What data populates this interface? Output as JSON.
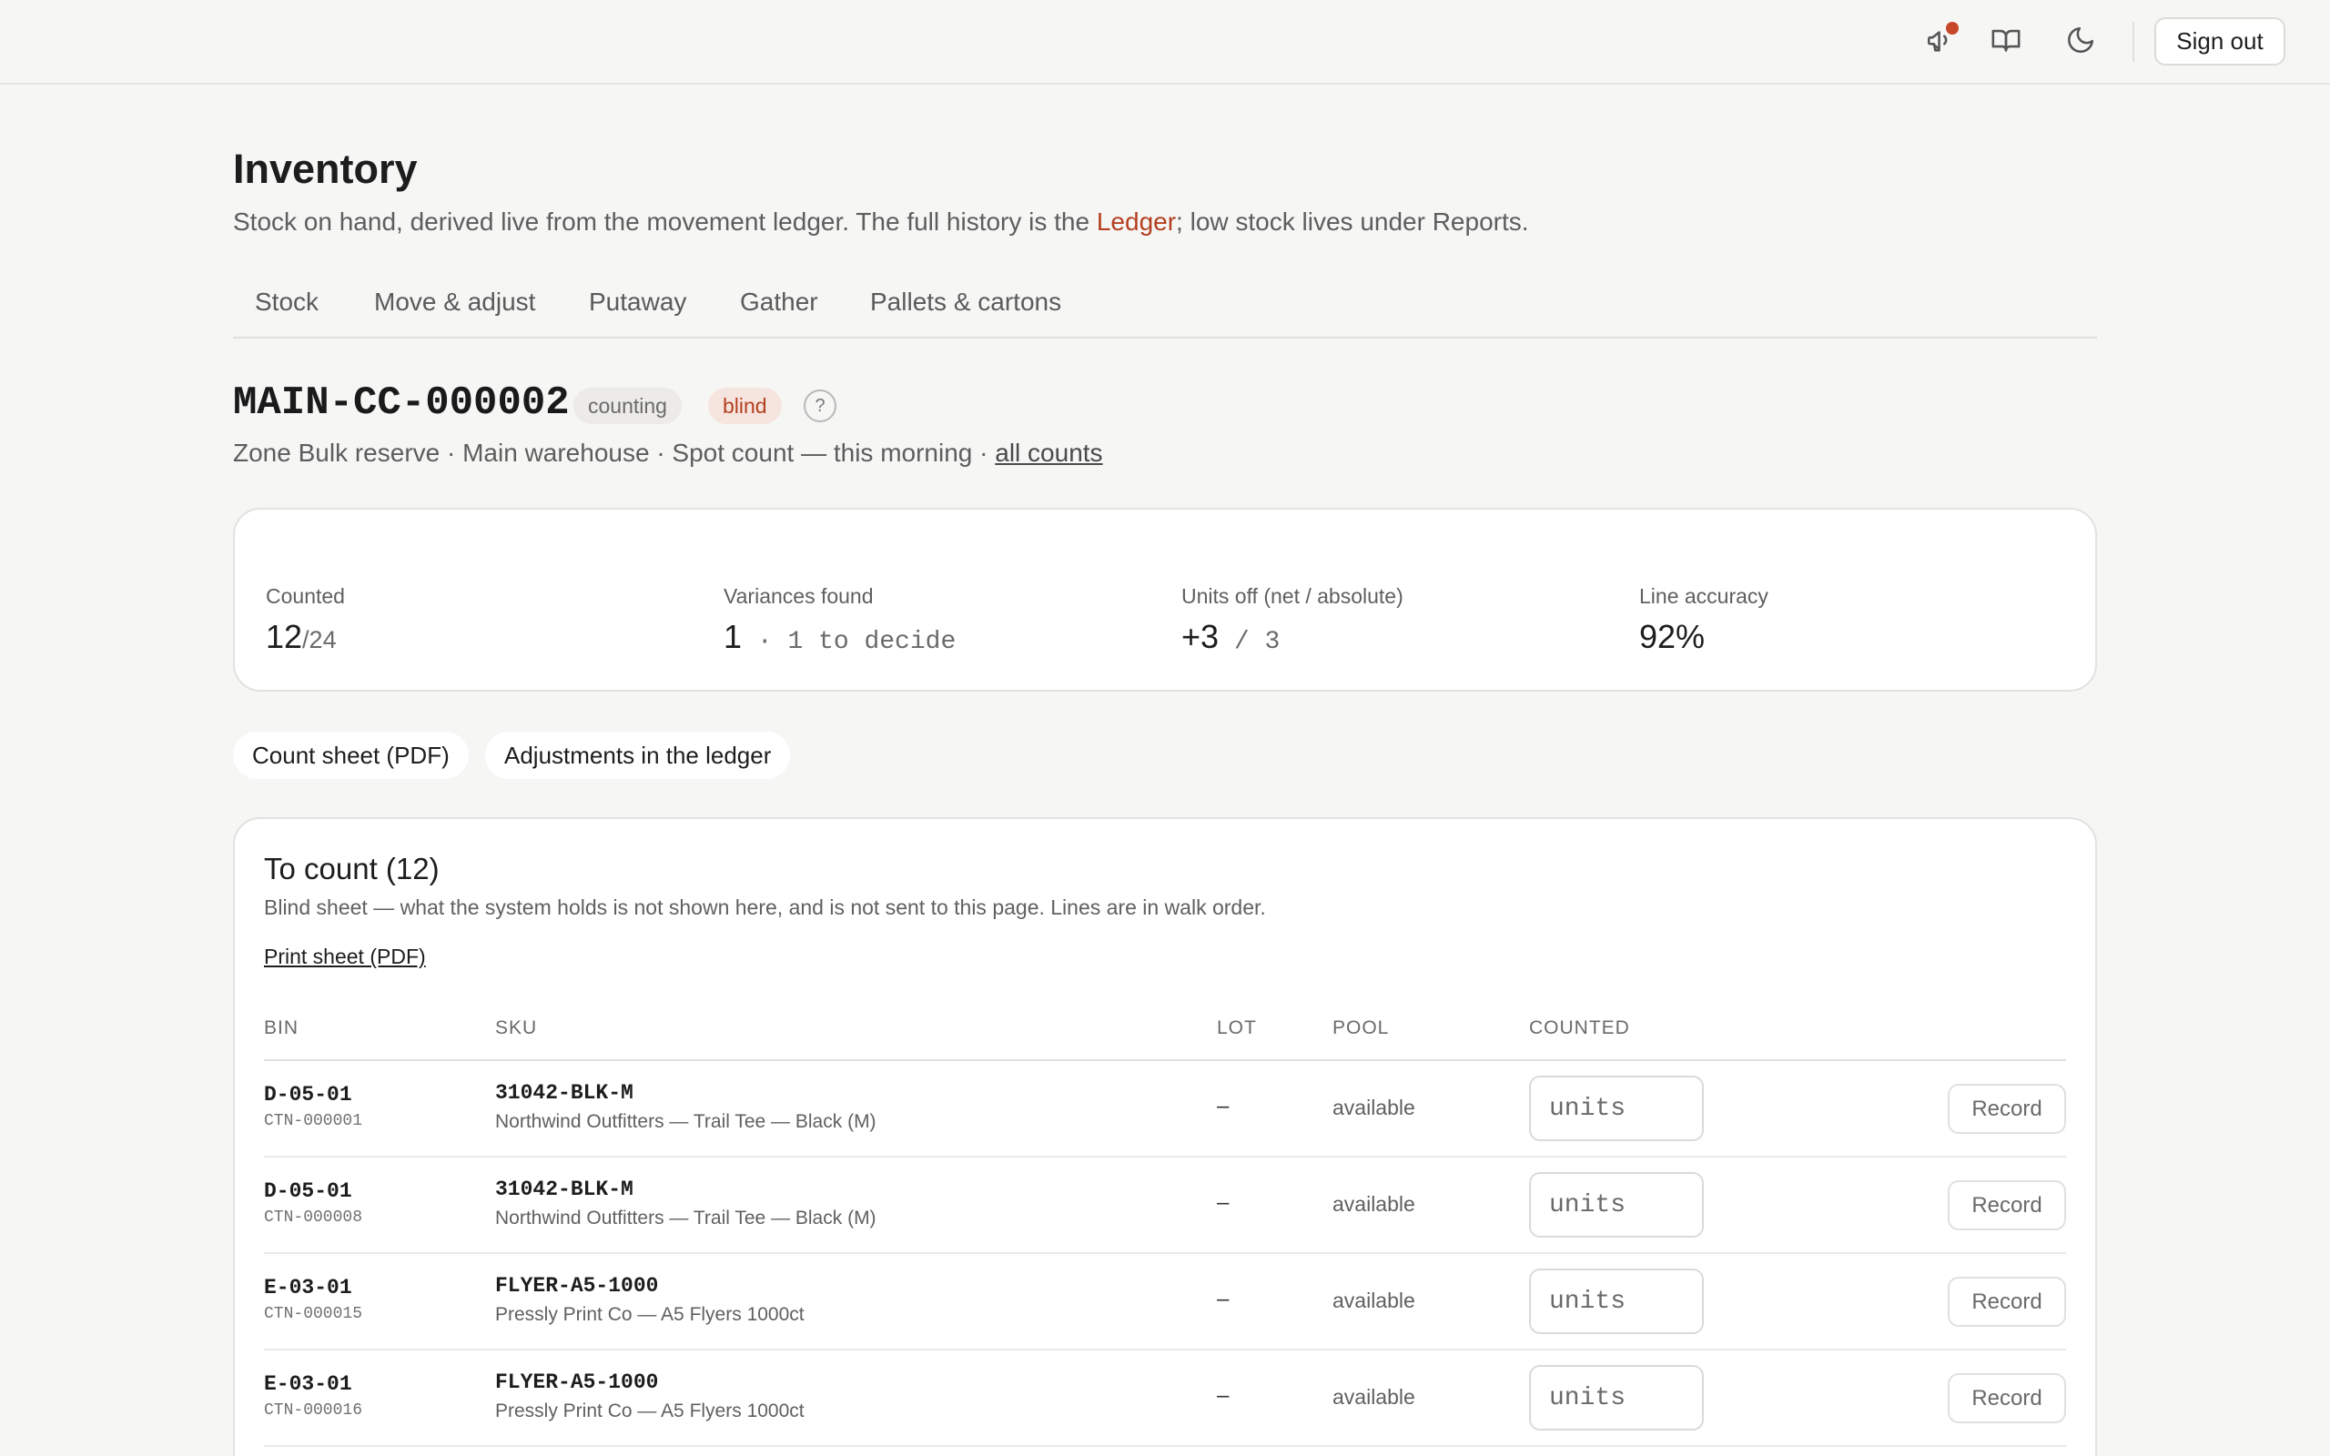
{
  "header": {
    "sign_out_label": "Sign out",
    "icons": [
      "megaphone-icon",
      "book-open-icon",
      "moon-icon"
    ],
    "notification_dot_color": "#c8472b"
  },
  "page": {
    "title": "Inventory",
    "subtitle_before": "Stock on hand, derived live from the movement ledger. The full history is the ",
    "subtitle_link": "Ledger",
    "subtitle_after": "; low stock lives under Reports."
  },
  "tabs": [
    {
      "label": "Stock"
    },
    {
      "label": "Move & adjust"
    },
    {
      "label": "Putaway"
    },
    {
      "label": "Gather"
    },
    {
      "label": "Pallets & cartons"
    }
  ],
  "count": {
    "id": "MAIN-CC-000002",
    "badge_status": "counting",
    "badge_mode": "blind",
    "help": "?",
    "meta": "Zone Bulk reserve · Main warehouse · Spot count — this morning · ",
    "all_counts_link": "all counts"
  },
  "stats": {
    "counted_label": "Counted",
    "counted_value": "12",
    "counted_total": "/24",
    "variances_label": "Variances found",
    "variances_value": "1",
    "variances_extra": " · 1 to decide",
    "units_off_label": "Units off (net / absolute)",
    "units_off_net": "+3",
    "units_off_abs": " / 3",
    "accuracy_label": "Line accuracy",
    "accuracy_value": "92%"
  },
  "actions": {
    "count_sheet": "Count sheet (PDF)",
    "adjustments": "Adjustments in the ledger"
  },
  "to_count": {
    "title": "To count (12)",
    "subtitle": "Blind sheet — what the system holds is not shown here, and is not sent to this page. Lines are in walk order.",
    "print_link": "Print sheet (PDF)",
    "columns": {
      "bin": "BIN",
      "sku": "SKU",
      "lot": "LOT",
      "pool": "POOL",
      "counted": "COUNTED"
    },
    "rows": [
      {
        "bin": "D-05-01",
        "carton": "CTN-000001",
        "sku": "31042-BLK-M",
        "desc": "Northwind Outfitters — Trail Tee — Black (M)",
        "lot": "–",
        "pool": "available",
        "placeholder": "units",
        "action": "Record"
      },
      {
        "bin": "D-05-01",
        "carton": "CTN-000008",
        "sku": "31042-BLK-M",
        "desc": "Northwind Outfitters — Trail Tee — Black (M)",
        "lot": "–",
        "pool": "available",
        "placeholder": "units",
        "action": "Record"
      },
      {
        "bin": "E-03-01",
        "carton": "CTN-000015",
        "sku": "FLYER-A5-1000",
        "desc": "Pressly Print Co — A5 Flyers 1000ct",
        "lot": "–",
        "pool": "available",
        "placeholder": "units",
        "action": "Record"
      },
      {
        "bin": "E-03-01",
        "carton": "CTN-000016",
        "sku": "FLYER-A5-1000",
        "desc": "Pressly Print Co — A5 Flyers 1000ct",
        "lot": "–",
        "pool": "available",
        "placeholder": "units",
        "action": "Record"
      }
    ]
  },
  "colors": {
    "accent": "#b4401f",
    "blind_badge_bg": "#f6e4de",
    "page_bg": "#f6f6f5"
  }
}
